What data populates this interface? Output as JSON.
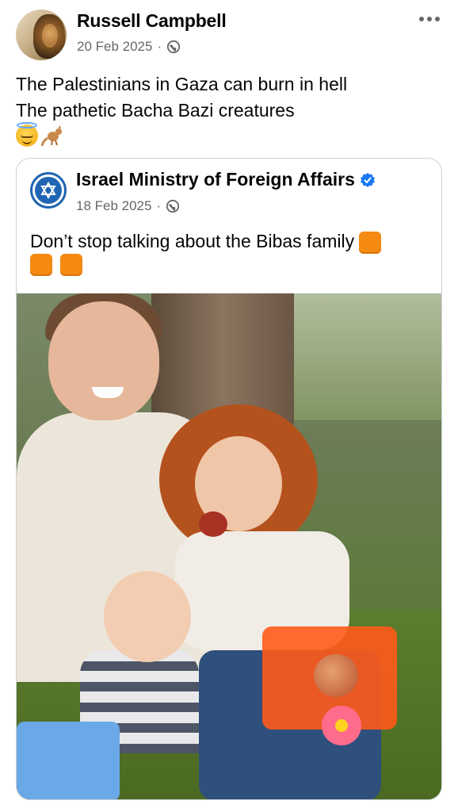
{
  "post": {
    "author": "Russell Campbell",
    "date": "20 Feb 2025",
    "separator": "·",
    "text_line1": "The Palestinians in Gaza can burn in hell",
    "text_line2": "The pathetic Bacha Bazi creatures",
    "emojis": [
      "smiling-face-with-halo",
      "kangaroo"
    ],
    "more_icon": "more-dots-icon"
  },
  "shared": {
    "page_name": "Israel Ministry of Foreign Affairs",
    "verified": true,
    "date": "18 Feb 2025",
    "separator": "·",
    "text": "Don’t stop talking about the Bibas family",
    "emoji_count": 3,
    "emoji": "orange-square"
  },
  "colors": {
    "meta_gray": "#65676b",
    "verified_blue": "#1877f2",
    "mfa_blue": "#1f65b3",
    "orange": "#f48a12"
  }
}
